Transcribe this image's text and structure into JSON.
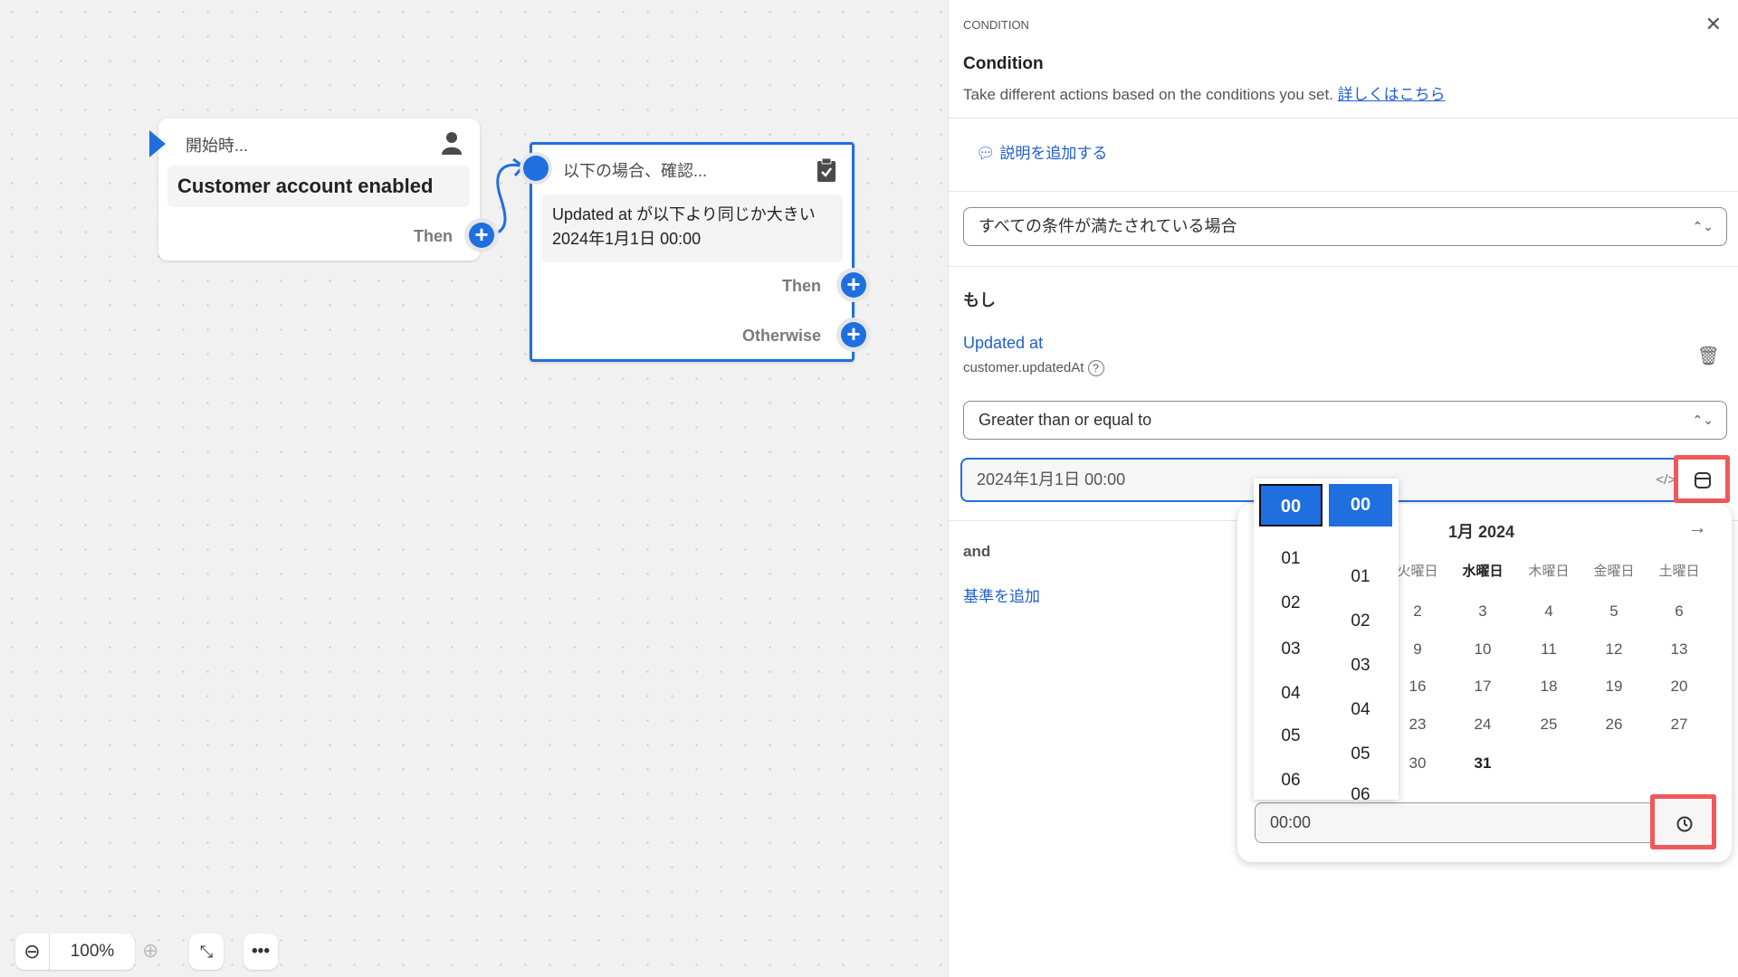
{
  "canvas": {
    "trigger_node": {
      "title": "開始時...",
      "body": "Customer account enabled",
      "then_label": "Then",
      "icon": "person-icon"
    },
    "condition_node": {
      "title": "以下の場合、確認...",
      "body_line1": "Updated at が以下より同じか大きい",
      "body_line2": "2024年1月1日 00:00",
      "then_label": "Then",
      "otherwise_label": "Otherwise",
      "icon": "clipboard-check-icon"
    },
    "toolbar": {
      "zoom_level": "100%"
    }
  },
  "panel": {
    "eyebrow": "CONDITION",
    "title": "Condition",
    "description": "Take different actions based on the conditions you set.",
    "learn_more": "詳しくはこちら",
    "add_description": "説明を追加する",
    "match_select": "すべての条件が満たされている場合",
    "if_label": "もし",
    "field_name": "Updated at",
    "field_path": "customer.updatedAt",
    "operator_select": "Greater than or equal to",
    "date_value": "2024年1月1日 00:00",
    "and_label": "and",
    "add_criteria": "基準を追加"
  },
  "datepicker": {
    "month_label": "1月 2024",
    "weekdays": [
      "火曜日",
      "水曜日",
      "木曜日",
      "金曜日",
      "土曜日"
    ],
    "weeks": [
      [
        "2",
        "3",
        "4",
        "5",
        "6"
      ],
      [
        "9",
        "10",
        "11",
        "12",
        "13"
      ],
      [
        "16",
        "17",
        "18",
        "19",
        "20"
      ],
      [
        "23",
        "24",
        "25",
        "26",
        "27"
      ],
      [
        "30",
        "31",
        "",
        "",
        ""
      ]
    ],
    "time_value": "00:00",
    "hours": [
      "00",
      "01",
      "02",
      "03",
      "04",
      "05",
      "06"
    ],
    "minutes": [
      "00",
      "01",
      "02",
      "03",
      "04",
      "05",
      "06"
    ],
    "accent": "#1f6fe0"
  }
}
